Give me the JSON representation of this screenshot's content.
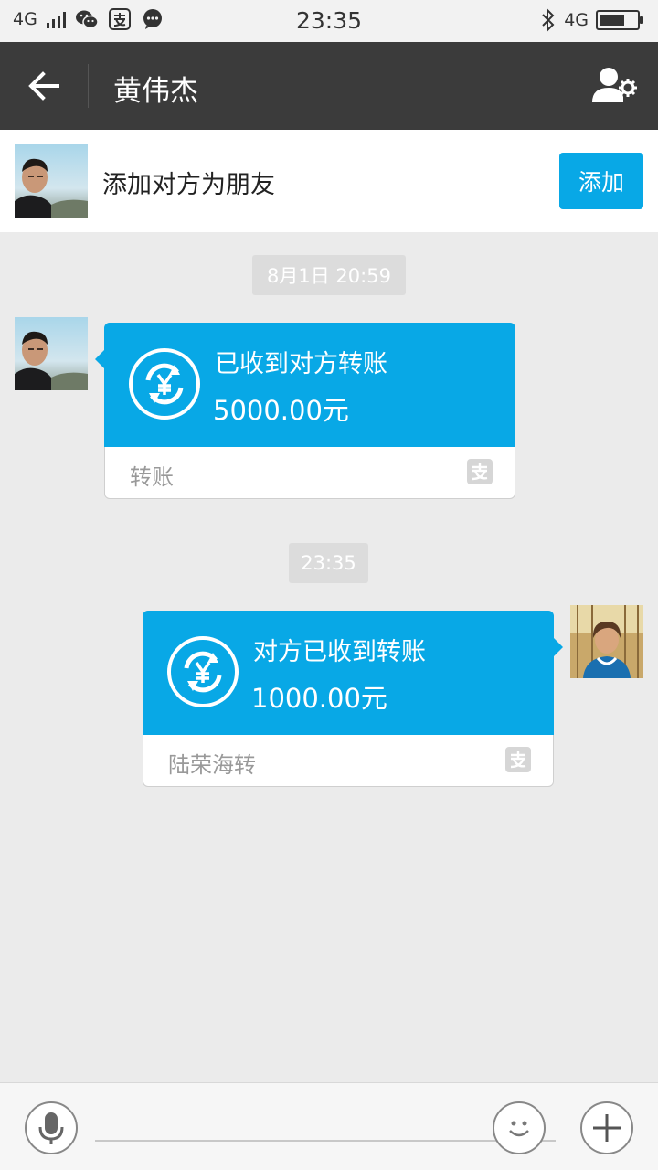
{
  "status_bar": {
    "network": "4G",
    "time": "23:35",
    "network_right": "4G",
    "icons": [
      "signal-icon",
      "wechat-icon",
      "alipay-icon",
      "message-icon",
      "bluetooth-icon",
      "battery-icon"
    ]
  },
  "header": {
    "title": "黄伟杰",
    "back_icon": "back-arrow-icon",
    "profile_icon": "contact-settings-icon"
  },
  "add_friend": {
    "text": "添加对方为朋友",
    "button_label": "添加"
  },
  "messages": [
    {
      "timestamp": "8月1日 20:59",
      "side": "left",
      "title": "已收到对方转账",
      "amount": "5000.00元",
      "footer": "转账"
    },
    {
      "timestamp": "23:35",
      "side": "right",
      "title": "对方已收到转账",
      "amount": "1000.00元",
      "footer": "陆荣海转"
    }
  ],
  "input_bar": {
    "placeholder": "",
    "voice_icon": "microphone-icon",
    "emoji_icon": "smiley-icon",
    "more_icon": "plus-icon"
  },
  "colors": {
    "accent": "#08a8e6",
    "header_bg": "#3b3b3b",
    "chat_bg": "#ebebeb"
  }
}
